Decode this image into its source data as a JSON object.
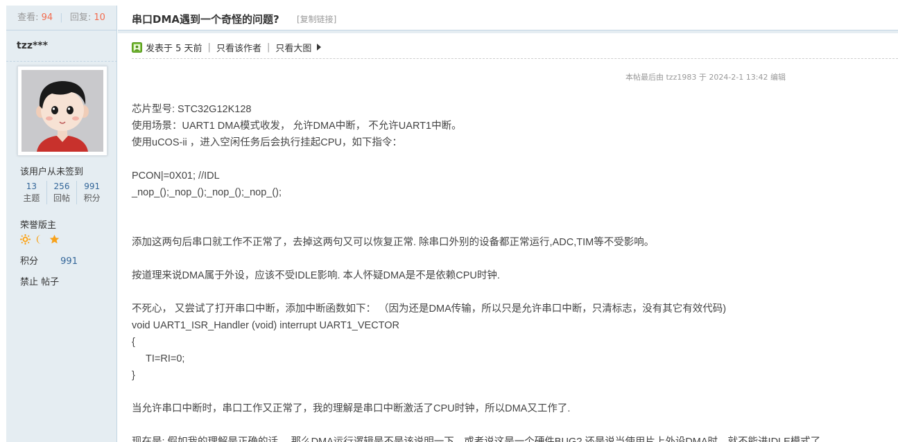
{
  "sidebar": {
    "views_label": "查看:",
    "views_value": "94",
    "replies_label": "回复:",
    "replies_value": "10",
    "username": "tzz***",
    "sign_status": "该用户从未签到",
    "counts": [
      {
        "value": "13",
        "label": "主题"
      },
      {
        "value": "256",
        "label": "回帖"
      },
      {
        "value": "991",
        "label": "积分"
      }
    ],
    "honor": "荣誉版主",
    "points_label": "积分",
    "points_value": "991",
    "ban": "禁止 帖子"
  },
  "thread": {
    "title": "串口DMA遇到一个奇怪的问题?",
    "copy_link": "[复制链接]"
  },
  "post_meta": {
    "posted": "发表于 5 天前",
    "author_only": "只看该作者",
    "big_image": "只看大图",
    "edit_note": "本帖最后由 tzz1983 于 2024-2-1 13:42 编辑"
  },
  "post_lines": [
    "芯片型号:   STC32G12K128",
    "使用场景：UART1    DMA模式收发，  允许DMA中断，  不允许UART1中断。",
    "使用uCOS-ii ，进入空闲任务后会执行挂起CPU，如下指令：",
    "",
    "PCON|=0X01;      //IDL",
    "_nop_();_nop_();_nop_();_nop_();",
    "",
    "",
    "添加这两句后串口就工作不正常了，去掉这两句又可以恢复正常.  除串口外别的设备都正常运行,ADC,TIM等不受影响。",
    "",
    "按道理来说DMA属于外设，应该不受IDLE影响. 本人怀疑DMA是不是依赖CPU时钟.",
    "",
    "不死心，  又尝试了打开串口中断，添加中断函数如下：   （因为还是DMA传输，所以只是允许串口中断，只清标志，没有其它有效代码)",
    "void UART1_ISR_Handler (void) interrupt UART1_VECTOR",
    "{",
    "TI=RI=0;",
    "}",
    "",
    "当允许串口中断时，串口工作又正常了，我的理解是串口中断激活了CPU时钟，所以DMA又工作了.",
    "",
    "现在是: 假如我的理解是正确的话，  那么DMA运行逻辑是不是该说明一下，或者说这是一个硬件BUG?   还是说当使用片上外设DMA时，就不能进IDLE模式了"
  ],
  "colors": {
    "sidebar_bg": "#e5edf2",
    "border": "#c2d5e3",
    "accent_count": "#f26c4f",
    "link_blue": "#336699"
  }
}
